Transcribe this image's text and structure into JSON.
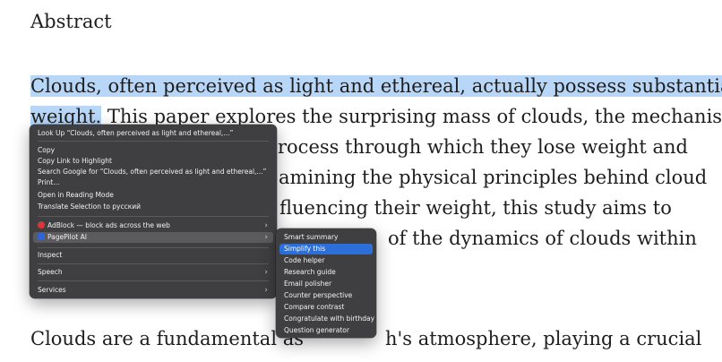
{
  "document": {
    "heading": "Abstract",
    "selected_text": "Clouds, often perceived as light and ethereal, actually possess substantial",
    "selected_tail": "weight.",
    "line2_rest": " This paper explores the surprising mass of clouds, the mechanisms",
    "line3": "rocess through which they lose weight and",
    "line4": "amining the physical principles behind cloud",
    "line5": "fluencing their weight, this study aims to",
    "line6": "of the dynamics of clouds within",
    "para2_start": "Clouds are a fundamental as",
    "para2_end": "h's atmosphere, playing a crucial"
  },
  "context_menu": {
    "look_up": "Look Up “Clouds, often perceived as light and ethereal,...”",
    "copy": "Copy",
    "copy_link": "Copy Link to Highlight",
    "search_google": "Search Google for “Clouds, often perceived as light and ethereal,...”",
    "print": "Print...",
    "reading_mode": "Open in Reading Mode",
    "translate": "Translate Selection to русский",
    "adblock": "AdBlock — block ads across the web",
    "pagepilot": "PagePilot AI",
    "inspect": "Inspect",
    "speech": "Speech",
    "services": "Services"
  },
  "submenu": {
    "items": [
      "Smart summary",
      "Simplify this",
      "Code helper",
      "Research guide",
      "Email polisher",
      "Counter perspective",
      "Compare  contrast",
      "Congratulate with birthday",
      "Question generator"
    ]
  }
}
